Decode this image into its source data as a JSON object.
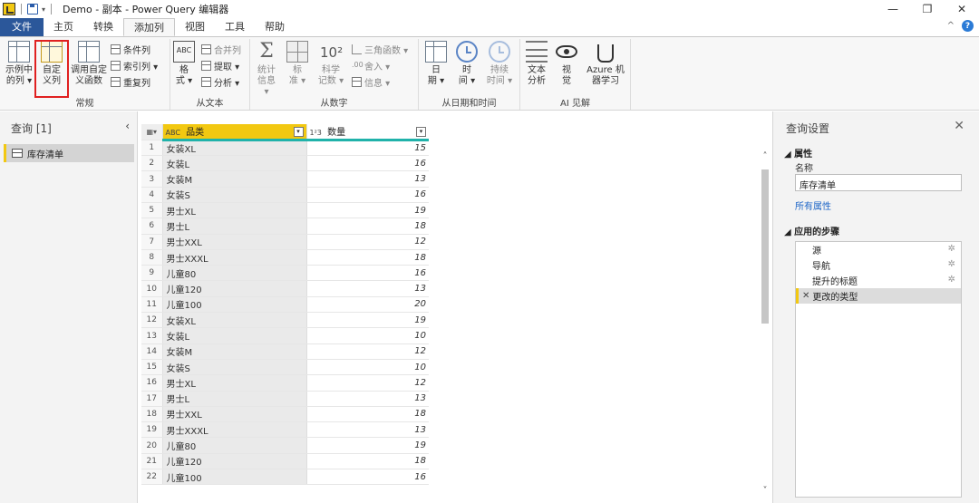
{
  "window": {
    "title": "Demo - 副本 - Power Query 编辑器",
    "controls": [
      "—",
      "❐",
      "✕"
    ]
  },
  "tabs": [
    "文件",
    "主页",
    "转换",
    "添加列",
    "视图",
    "工具",
    "帮助"
  ],
  "ribbon": {
    "general": {
      "label": "常规",
      "example_col": [
        "示例中",
        "的列 ▾"
      ],
      "custom_col": [
        "自定",
        "义列"
      ],
      "invoke_func": [
        "调用自定",
        "义函数"
      ],
      "cond_col": "条件列",
      "index_col": "索引列 ▾",
      "dup_col": "重复列"
    },
    "text": {
      "label": "从文本",
      "format": [
        "格",
        "式 ▾"
      ],
      "merge": "合并列",
      "extract": "提取 ▾",
      "parse": "分析 ▾"
    },
    "number": {
      "label": "从数字",
      "stats": [
        "统计",
        "信息 ▾"
      ],
      "standard": [
        "标",
        "准 ▾"
      ],
      "scientific": [
        "科学",
        "记数 ▾"
      ],
      "trig": "三角函数 ▾",
      "round": "舍入 ▾",
      "info": "信息 ▾"
    },
    "datetime": {
      "label": "从日期和时间",
      "date": [
        "日",
        "期 ▾"
      ],
      "time": [
        "时",
        "间 ▾"
      ],
      "duration": [
        "持续",
        "时间 ▾"
      ]
    },
    "ai": {
      "label": "AI 见解",
      "text_analytics": [
        "文本",
        "分析"
      ],
      "vision": [
        "视",
        "觉"
      ],
      "azure_ml": [
        "Azure 机",
        "器学习"
      ]
    }
  },
  "queries_pane": {
    "title": "查询 [1]",
    "collapse": "‹",
    "items": [
      "库存清单"
    ]
  },
  "grid": {
    "columns": [
      {
        "type": "ABC",
        "name": "品类"
      },
      {
        "type": "1²3",
        "name": "数量"
      }
    ],
    "rows": [
      [
        "1",
        "女装XL",
        "15"
      ],
      [
        "2",
        "女装L",
        "16"
      ],
      [
        "3",
        "女装M",
        "13"
      ],
      [
        "4",
        "女装S",
        "16"
      ],
      [
        "5",
        "男士XL",
        "19"
      ],
      [
        "6",
        "男士L",
        "18"
      ],
      [
        "7",
        "男士XXL",
        "12"
      ],
      [
        "8",
        "男士XXXL",
        "18"
      ],
      [
        "9",
        "儿童80",
        "16"
      ],
      [
        "10",
        "儿童120",
        "13"
      ],
      [
        "11",
        "儿童100",
        "20"
      ],
      [
        "12",
        "女装XL",
        "19"
      ],
      [
        "13",
        "女装L",
        "10"
      ],
      [
        "14",
        "女装M",
        "12"
      ],
      [
        "15",
        "女装S",
        "10"
      ],
      [
        "16",
        "男士XL",
        "12"
      ],
      [
        "17",
        "男士L",
        "13"
      ],
      [
        "18",
        "男士XXL",
        "18"
      ],
      [
        "19",
        "男士XXXL",
        "13"
      ],
      [
        "20",
        "儿童80",
        "19"
      ],
      [
        "21",
        "儿童120",
        "18"
      ],
      [
        "22",
        "儿童100",
        "16"
      ]
    ]
  },
  "settings_pane": {
    "title": "查询设置",
    "close": "✕",
    "properties_section": "◢ 属性",
    "name_label": "名称",
    "name_value": "库存清单",
    "all_props_link": "所有属性",
    "steps_section": "◢ 应用的步骤",
    "steps": [
      "源",
      "导航",
      "提升的标题",
      "更改的类型"
    ],
    "selected_step_marker": "✕"
  }
}
